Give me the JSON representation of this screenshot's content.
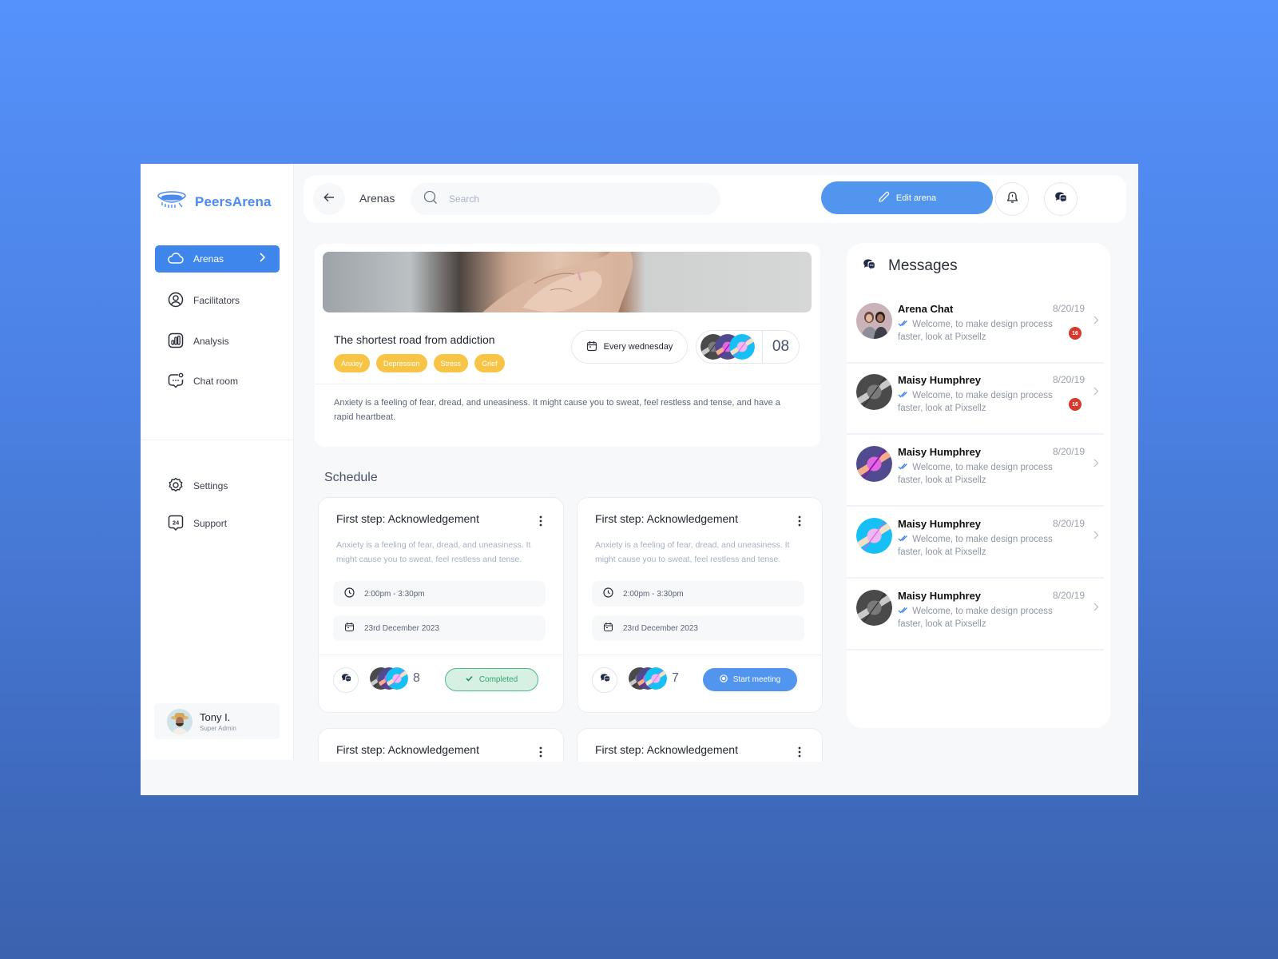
{
  "app": {
    "name": "PeersArena",
    "brand_color": "#3f86ec"
  },
  "sidebar": {
    "items": [
      {
        "label": "Arenas",
        "icon": "cloud-icon",
        "active": true
      },
      {
        "label": "Facilitators",
        "icon": "user-circle-icon"
      },
      {
        "label": "Analysis",
        "icon": "bar-chart-icon"
      },
      {
        "label": "Chat room",
        "icon": "chat-bubble-icon"
      }
    ],
    "bottom_items": [
      {
        "label": "Settings",
        "icon": "gear-icon"
      },
      {
        "label": "Support",
        "icon": "support-24-icon"
      }
    ],
    "user": {
      "name": "Tony I.",
      "role": "Super Admin"
    }
  },
  "topbar": {
    "breadcrumb": "Arenas",
    "search_placeholder": "Search",
    "edit_label": "Edit arena"
  },
  "arena": {
    "title": "The shortest road from addiction",
    "tags": [
      "Anxiey",
      "Depression",
      "Stress",
      "Grief"
    ],
    "frequency": "Every wednesday",
    "member_count": "08",
    "description": "Anxiety is a feeling of fear, dread, and uneasiness. It might cause you to sweat, feel restless and tense, and have a rapid heartbeat."
  },
  "schedule": {
    "title": "Schedule",
    "cards": [
      {
        "title": "First step: Acknowledgement",
        "description": "Anxiety is a feeling of fear, dread, and uneasiness. It might cause you to sweat, feel restless and tense.",
        "time": "2:00pm - 3:30pm",
        "date": "23rd December 2023",
        "participants": "8",
        "status": "Completed"
      },
      {
        "title": "First step: Acknowledgement",
        "description": "Anxiety is a feeling of fear, dread, and uneasiness. It might cause you to sweat, feel restless and tense.",
        "time": "2:00pm - 3:30pm",
        "date": "23rd December 2023",
        "participants": "7",
        "action": "Start meeting"
      },
      {
        "title": "First step: Acknowledgement"
      },
      {
        "title": "First step: Acknowledgement"
      }
    ]
  },
  "messages": {
    "title": "Messages",
    "items": [
      {
        "name": "Arena Chat",
        "date": "8/20/19",
        "text": "Welcome, to make design process faster, look at Pixsellz",
        "unread": "16"
      },
      {
        "name": "Maisy Humphrey",
        "date": "8/20/19",
        "text": "Welcome, to make design process faster, look at Pixsellz",
        "unread": "16"
      },
      {
        "name": "Maisy Humphrey",
        "date": "8/20/19",
        "text": "Welcome, to make design process faster, look at Pixsellz"
      },
      {
        "name": "Maisy Humphrey",
        "date": "8/20/19",
        "text": "Welcome, to make design process faster, look at Pixsellz"
      },
      {
        "name": "Maisy Humphrey",
        "date": "8/20/19",
        "text": "Welcome, to make design process faster, look at Pixsellz"
      }
    ]
  }
}
